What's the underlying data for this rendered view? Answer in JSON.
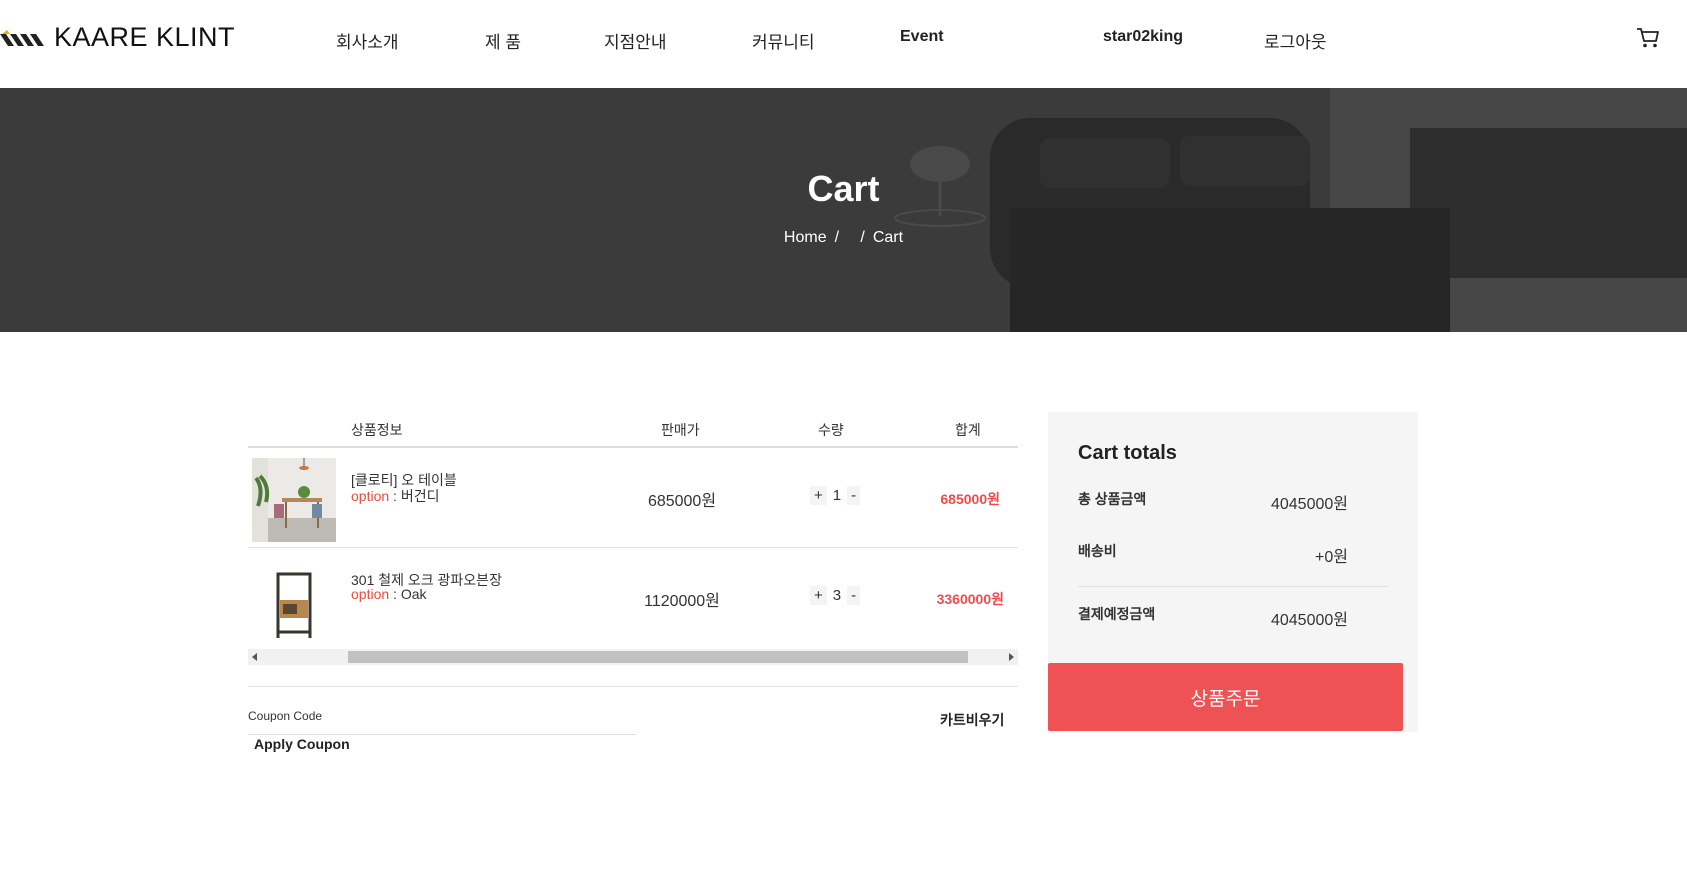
{
  "header": {
    "logo_text": "KAARE KLINT",
    "nav": [
      "회사소개",
      "제 품",
      "지점안내",
      "커뮤니티",
      "Event",
      "star02king",
      "로그아웃"
    ]
  },
  "hero": {
    "title": "Cart",
    "breadcrumb_home": "Home",
    "breadcrumb_sep1": "/",
    "breadcrumb_sep2": "/",
    "breadcrumb_current": "Cart"
  },
  "cart": {
    "columns": [
      "상품정보",
      "판매가",
      "수량",
      "합계"
    ],
    "items": [
      {
        "name": "[클로티] 오 테이블",
        "option_label": "option",
        "option_value": " : 버건디",
        "price": "685000원",
        "qty_plus": "+",
        "qty": "1",
        "qty_minus": "-",
        "total": "685000원"
      },
      {
        "name": "301 철제 오크 광파오븐장",
        "option_label": "option",
        "option_value": " : Oak",
        "price": "1120000원",
        "qty_plus": "+",
        "qty": "3",
        "qty_minus": "-",
        "total": "3360000원"
      }
    ],
    "coupon_label": "Coupon Code",
    "apply_coupon": "Apply Coupon",
    "clear_cart": "카트비우기"
  },
  "totals": {
    "title": "Cart totals",
    "subtotal_label": "총 상품금액",
    "subtotal_value": "4045000원",
    "shipping_label": "배송비",
    "shipping_value": "+0원",
    "grand_label": "결제예정금액",
    "grand_value": "4045000원",
    "order_button": "상품주문"
  },
  "colors": {
    "accent": "#ef5255",
    "price_red": "#ef4b4b",
    "hero_bg": "#3a3a3a"
  }
}
